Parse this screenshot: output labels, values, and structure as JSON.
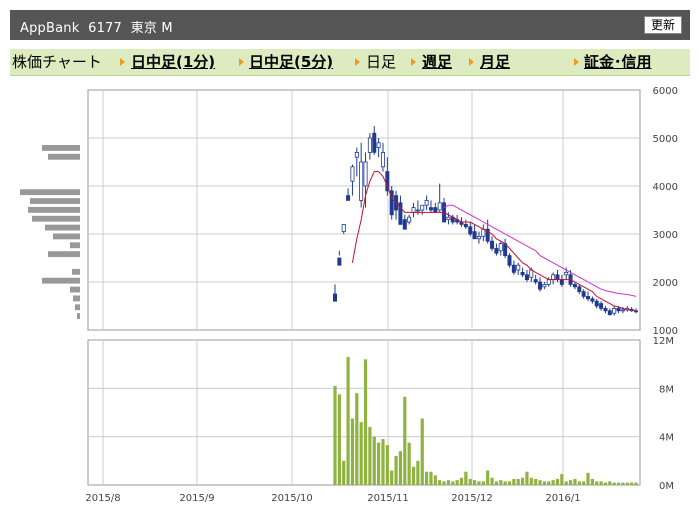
{
  "header": {
    "title": "AppBank  6177  東京 M",
    "refresh_label": "更新"
  },
  "tabs": [
    {
      "label": "株価チャート",
      "link": false,
      "arrow": false
    },
    {
      "label": "日中足(1分)",
      "link": true,
      "arrow": true
    },
    {
      "label": "日中足(5分)",
      "link": true,
      "arrow": true
    },
    {
      "label": "日足",
      "link": false,
      "arrow": true
    },
    {
      "label": "週足",
      "link": true,
      "arrow": true
    },
    {
      "label": "月足",
      "link": true,
      "arrow": true
    },
    {
      "label": "証金･信用",
      "link": true,
      "arrow": true
    }
  ],
  "colors": {
    "up": "#ffffff",
    "down": "#1f3a93",
    "ma_short": "#c8102e",
    "ma_long": "#cc33cc",
    "volume": "#8fb340",
    "profile": "#999999",
    "grid": "#cccccc",
    "axis": "#444444"
  },
  "chart_data": [
    {
      "type": "candlestick",
      "title": "",
      "ylim": [
        1000,
        6000
      ],
      "y_ticks": [
        "6000",
        "5000",
        "4000",
        "3000",
        "2000",
        "1000"
      ],
      "x_ticks": [
        "2015/8",
        "2015/9",
        "2015/10",
        "2015/11",
        "2015/12",
        "2016/1"
      ],
      "grid": true,
      "candles": [
        [
          1750,
          1950,
          1600,
          1600
        ],
        [
          2500,
          2650,
          2550,
          2350
        ],
        [
          3050,
          3100,
          3000,
          3200
        ],
        [
          3800,
          3950,
          3750,
          3700
        ],
        [
          4100,
          4450,
          3800,
          4400
        ],
        [
          4600,
          4800,
          4200,
          4700
        ],
        [
          3700,
          4900,
          3550,
          4500
        ],
        [
          4000,
          4700,
          3550,
          4500
        ],
        [
          4700,
          5100,
          4550,
          5000
        ],
        [
          5100,
          5250,
          4650,
          4700
        ],
        [
          4800,
          5000,
          4600,
          4900
        ],
        [
          4400,
          4900,
          4300,
          4700
        ],
        [
          4300,
          4600,
          3800,
          3900
        ],
        [
          3900,
          4000,
          3300,
          3400
        ],
        [
          3800,
          3900,
          3300,
          3500
        ],
        [
          3650,
          3800,
          3300,
          3200
        ],
        [
          3300,
          3400,
          3100,
          3100
        ],
        [
          3250,
          3400,
          3200,
          3350
        ],
        [
          3450,
          3650,
          3350,
          3550
        ],
        [
          3500,
          3700,
          3400,
          3500
        ],
        [
          3500,
          3600,
          3400,
          3600
        ],
        [
          3600,
          3800,
          3500,
          3700
        ],
        [
          3550,
          3700,
          3450,
          3500
        ],
        [
          3550,
          3650,
          3450,
          3450
        ],
        [
          3500,
          4050,
          3450,
          3650
        ],
        [
          3650,
          3750,
          3250,
          3250
        ],
        [
          3300,
          3450,
          3200,
          3350
        ],
        [
          3350,
          3400,
          3200,
          3250
        ],
        [
          3300,
          3400,
          3200,
          3250
        ],
        [
          3250,
          3350,
          3150,
          3200
        ],
        [
          3200,
          3300,
          3100,
          3150
        ],
        [
          3150,
          3250,
          2950,
          3000
        ],
        [
          3050,
          3200,
          2900,
          2900
        ],
        [
          2900,
          3050,
          2800,
          2950
        ],
        [
          2950,
          3200,
          2850,
          3100
        ],
        [
          3100,
          3300,
          2800,
          2850
        ],
        [
          2850,
          2950,
          2650,
          2700
        ],
        [
          2700,
          2800,
          2550,
          2600
        ],
        [
          2650,
          2850,
          2550,
          2800
        ],
        [
          2800,
          2900,
          2500,
          2550
        ],
        [
          2550,
          2600,
          2300,
          2350
        ],
        [
          2350,
          2450,
          2150,
          2200
        ],
        [
          2250,
          2400,
          2150,
          2350
        ],
        [
          2200,
          2300,
          2100,
          2150
        ],
        [
          2150,
          2250,
          2000,
          2050
        ],
        [
          2100,
          2300,
          2000,
          2250
        ],
        [
          2050,
          2150,
          1950,
          2000
        ],
        [
          2000,
          2100,
          1800,
          1850
        ],
        [
          1900,
          2000,
          1850,
          1950
        ],
        [
          1950,
          2100,
          1900,
          2050
        ],
        [
          2050,
          2200,
          1950,
          2150
        ],
        [
          2150,
          2250,
          2000,
          2050
        ],
        [
          2050,
          2150,
          1900,
          1950
        ],
        [
          2150,
          2300,
          2050,
          2200
        ],
        [
          2150,
          2250,
          1900,
          1950
        ],
        [
          1950,
          2000,
          1850,
          1900
        ],
        [
          1900,
          1950,
          1750,
          1800
        ],
        [
          1800,
          1850,
          1650,
          1700
        ],
        [
          1700,
          1800,
          1600,
          1650
        ],
        [
          1650,
          1700,
          1550,
          1600
        ],
        [
          1600,
          1650,
          1450,
          1500
        ],
        [
          1550,
          1600,
          1400,
          1450
        ],
        [
          1450,
          1500,
          1350,
          1400
        ],
        [
          1400,
          1450,
          1300,
          1320
        ],
        [
          1350,
          1500,
          1300,
          1450
        ],
        [
          1450,
          1500,
          1350,
          1400
        ],
        [
          1400,
          1480,
          1350,
          1420
        ],
        [
          1420,
          1500,
          1380,
          1450
        ],
        [
          1430,
          1480,
          1380,
          1400
        ],
        [
          1400,
          1450,
          1350,
          1380
        ]
      ],
      "ma_short": [
        null,
        null,
        null,
        null,
        2400,
        2900,
        3300,
        3800,
        4100,
        4300,
        4300,
        4200,
        4000,
        3750,
        3650,
        3550,
        3450,
        3450,
        3450,
        3450,
        3450,
        3450,
        3450,
        3450,
        3450,
        3450,
        3400,
        3350,
        3300,
        3250,
        3250,
        3250,
        3200,
        3150,
        3100,
        3050,
        3000,
        2900,
        2850,
        2800,
        2700,
        2600,
        2500,
        2400,
        2350,
        2250,
        2200,
        2150,
        2100,
        2050,
        2050,
        2050,
        2050,
        2050,
        2050,
        2000,
        1950,
        1900,
        1850,
        1800,
        1700,
        1650,
        1600,
        1550,
        1500,
        1480,
        1450,
        1420,
        1410,
        1400
      ],
      "ma_long": [
        null,
        null,
        null,
        null,
        null,
        null,
        null,
        null,
        null,
        null,
        null,
        null,
        null,
        null,
        null,
        null,
        null,
        null,
        null,
        null,
        null,
        null,
        null,
        null,
        null,
        3550,
        3600,
        3600,
        3550,
        3500,
        3450,
        3400,
        3350,
        3300,
        3250,
        3200,
        3150,
        3100,
        3050,
        3000,
        2950,
        2900,
        2850,
        2800,
        2750,
        2700,
        2650,
        2550,
        2500,
        2450,
        2400,
        2350,
        2300,
        2250,
        2200,
        2150,
        2100,
        2050,
        2000,
        1950,
        1900,
        1850,
        1820,
        1800,
        1780,
        1760,
        1750,
        1740,
        1720,
        1700
      ],
      "volume_profile_widths": [
        38,
        32,
        0,
        0,
        0,
        60,
        50,
        52,
        48,
        35,
        27,
        10,
        32,
        0,
        8,
        38,
        10,
        7,
        5,
        3
      ]
    },
    {
      "type": "bar",
      "title": "",
      "ylim": [
        0,
        12
      ],
      "y_ticks": [
        "12M",
        "8M",
        "4M",
        "0M"
      ],
      "values_millions": [
        8.2,
        7.5,
        2.0,
        10.6,
        5.5,
        7.6,
        5.2,
        10.4,
        4.8,
        4.0,
        3.5,
        3.8,
        3.3,
        1.2,
        2.4,
        2.8,
        7.3,
        3.5,
        1.5,
        2.0,
        5.5,
        1.1,
        1.1,
        0.8,
        0.4,
        0.3,
        0.4,
        0.3,
        0.4,
        0.6,
        1.1,
        0.5,
        0.4,
        0.3,
        0.3,
        1.2,
        0.6,
        0.3,
        0.4,
        0.3,
        0.3,
        0.5,
        0.5,
        0.6,
        1.1,
        0.6,
        0.5,
        0.4,
        0.3,
        0.3,
        0.4,
        0.5,
        0.9,
        0.3,
        0.4,
        0.5,
        0.3,
        0.3,
        1.0,
        0.5,
        0.3,
        0.3,
        0.2,
        0.3,
        0.2,
        0.2,
        0.2,
        0.2,
        0.2,
        0.2
      ]
    }
  ]
}
